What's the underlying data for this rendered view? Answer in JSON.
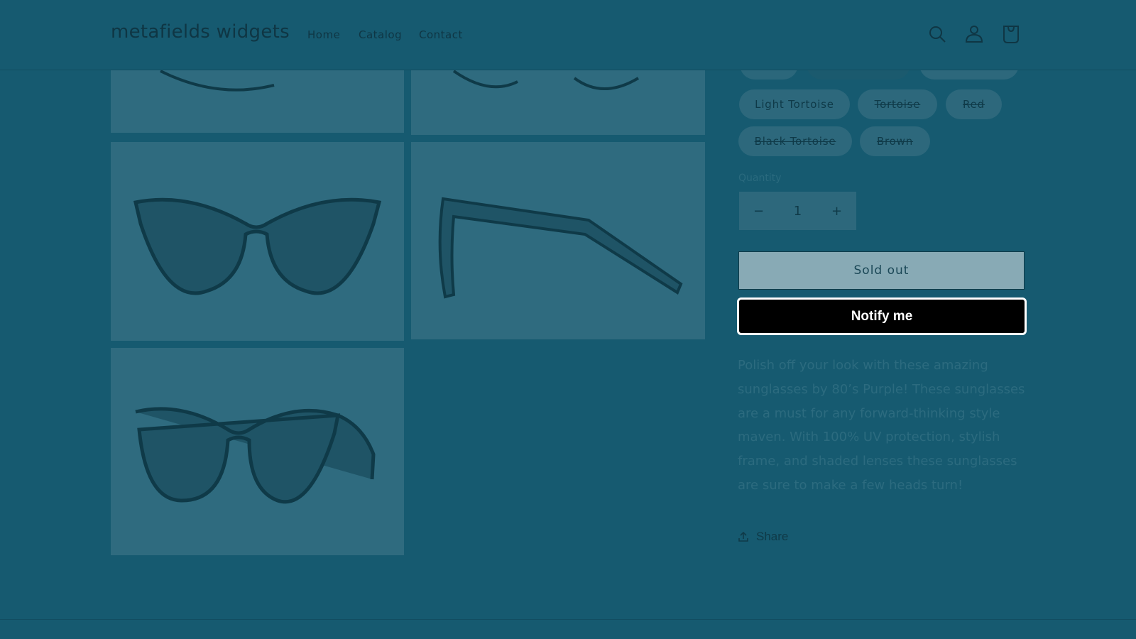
{
  "header": {
    "logo": "metafields widgets",
    "nav": [
      "Home",
      "Catalog",
      "Contact"
    ],
    "icons": [
      "search-icon",
      "account-icon",
      "cart-icon"
    ]
  },
  "product": {
    "color_options": [
      {
        "label": "Light Tortoise",
        "available": true
      },
      {
        "label": "Tortoise",
        "available": false
      },
      {
        "label": "Red",
        "available": false
      },
      {
        "label": "Black Tortoise",
        "available": false
      },
      {
        "label": "Brown",
        "available": false
      }
    ],
    "quantity_label": "Quantity",
    "quantity": "1",
    "decrease": "−",
    "increase": "+",
    "sold_out_label": "Sold out",
    "notify_label": "Notify me",
    "description": "Polish off your look with these amazing sunglasses by 80’s Purple! These sunglasses are a must for any forward-thinking style maven. With 100% UV protection, stylish frame, and shaded lenses these sunglasses are sure to make a few heads turn!",
    "share_label": "Share"
  },
  "colors": {
    "overlay": "#165a70",
    "notify_bg": "#000000",
    "sold_out_bg": "#88aab5"
  }
}
